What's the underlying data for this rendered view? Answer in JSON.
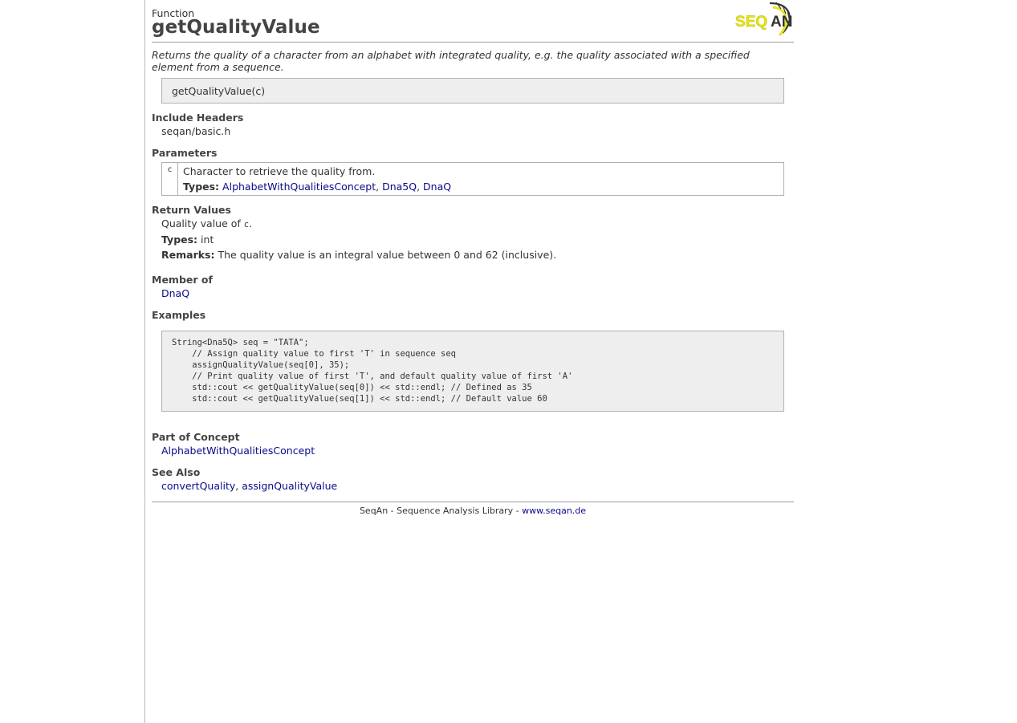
{
  "header": {
    "kind": "Function",
    "title": "getQualityValue",
    "logo_text": "SEQAN"
  },
  "summary": "Returns the quality of a character from an alphabet with integrated quality, e.g. the quality associated with a specified element from a sequence.",
  "signature": "getQualityValue(c)",
  "include_headers": {
    "heading": "Include Headers",
    "value": "seqan/basic.h"
  },
  "parameters": {
    "heading": "Parameters",
    "items": [
      {
        "name": "c",
        "description": "Character to retrieve the quality from.",
        "types_label": "Types:",
        "types": [
          "AlphabetWithQualitiesConcept",
          "Dna5Q",
          "DnaQ"
        ],
        "sep": ", "
      }
    ]
  },
  "return_values": {
    "heading": "Return Values",
    "text_prefix": "Quality value of ",
    "text_code": "c",
    "text_suffix": ".",
    "types_label": "Types:",
    "types_value": "int",
    "remarks_label": "Remarks:",
    "remarks_value": "The quality value is an integral value between 0 and 62 (inclusive)."
  },
  "member_of": {
    "heading": "Member of",
    "link": "DnaQ"
  },
  "examples": {
    "heading": "Examples",
    "code": "String<Dna5Q> seq = \"TATA\";\n    // Assign quality value to first 'T' in sequence seq\n    assignQualityValue(seq[0], 35);\n    // Print quality value of first 'T', and default quality value of first 'A'\n    std::cout << getQualityValue(seq[0]) << std::endl; // Defined as 35\n    std::cout << getQualityValue(seq[1]) << std::endl; // Default value 60"
  },
  "part_of_concept": {
    "heading": "Part of Concept",
    "link": "AlphabetWithQualitiesConcept"
  },
  "see_also": {
    "heading": "See Also",
    "links": [
      "convertQuality",
      "assignQualityValue"
    ],
    "sep": ", "
  },
  "footer": {
    "text": "SeqAn - Sequence Analysis Library - ",
    "link": "www.seqan.de"
  },
  "colors": {
    "link": "#0a0a8a",
    "logo_yellow": "#e8e41a",
    "box_bg": "#eeeeee"
  }
}
